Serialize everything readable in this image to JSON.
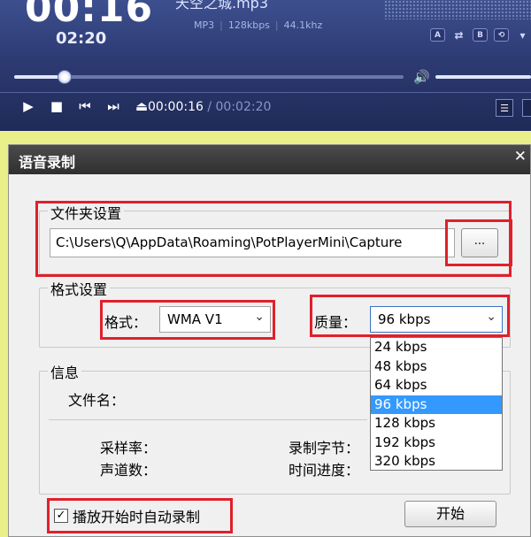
{
  "player": {
    "elapsed_big": "00:16",
    "total_small": "02:20",
    "track_title": "天空之城.mp3",
    "format": "MP3",
    "bitrate": "128kbps",
    "samplerate": "44.1khz",
    "mini_buttons": [
      "A",
      "⇄",
      "B",
      "⟲",
      "▾"
    ],
    "seek_progress": 0.13,
    "volume_level": 1.0,
    "time_current": "00:00:16",
    "time_separator": "/",
    "time_total": "00:02:20",
    "controls": {
      "play": "▶",
      "stop": "■",
      "prev": "⏮",
      "next": "⏭",
      "eject": "⏏",
      "playlist": "☰"
    },
    "volume_icon": "🔊"
  },
  "dialog": {
    "title": "语音录制",
    "close": "✕",
    "folder_group": {
      "label": "文件夹设置",
      "path_value": "C:\\Users\\Q\\AppData\\Roaming\\PotPlayerMini\\Capture",
      "browse_label": "..."
    },
    "format_group": {
      "label": "格式设置",
      "format_label": "格式：",
      "format_value": "WMA V1",
      "quality_label": "质量：",
      "quality_value": "96 kbps",
      "quality_options": [
        "24 kbps",
        "48 kbps",
        "64 kbps",
        "96 kbps",
        "128 kbps",
        "192 kbps",
        "320 kbps"
      ],
      "selected_index": 3
    },
    "info_group": {
      "label": "信息",
      "filename_label": "文件名：",
      "samplerate_label": "采样率：",
      "channels_label": "声道数：",
      "bytes_label": "录制字节：",
      "progress_label": "时间进度："
    },
    "auto_record": {
      "label": "播放开始时自动录制",
      "checked": true,
      "check_glyph": "✓"
    },
    "start_label": "开始"
  },
  "colors": {
    "highlight": "#e0202b",
    "selection": "#3399ff",
    "player_bg": "#2d3b73"
  }
}
